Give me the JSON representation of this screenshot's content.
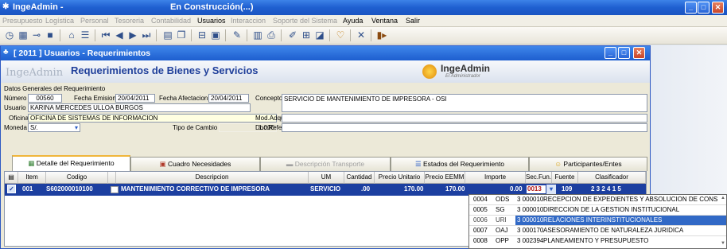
{
  "app": {
    "title": "IngeAdmin -",
    "status": "En Construcción(...)"
  },
  "menu": [
    {
      "label": "Presupuesto",
      "disabled": true
    },
    {
      "label": "Logística",
      "disabled": true
    },
    {
      "label": "Personal",
      "disabled": true
    },
    {
      "label": "Tesoreria",
      "disabled": true
    },
    {
      "label": "Contabilidad",
      "disabled": true
    },
    {
      "label": "Usuarios",
      "disabled": false
    },
    {
      "label": "Interaccion",
      "disabled": true
    },
    {
      "label": "Soporte del Sistema",
      "disabled": true
    },
    {
      "label": "Ayuda",
      "disabled": false
    },
    {
      "label": "Ventana",
      "disabled": false
    },
    {
      "label": "Salir",
      "disabled": false
    }
  ],
  "child": {
    "title": "[ 2011 ] Usuarios - Requerimientos",
    "brand": "IngeAdmin",
    "heading": "Requerimientos de Bienes y Servicios",
    "logo_main": "IngeAdmin",
    "logo_sub": "El Administrador"
  },
  "form": {
    "section": "Datos Generales del Requerimiento",
    "numero_label": "Número",
    "numero": "00560",
    "fecha_emision_label": "Fecha Emision",
    "fecha_emision": "20/04/2011",
    "fecha_afectacion_label": "Fecha Afectacion",
    "fecha_afectacion": "20/04/2011",
    "concepto_label": "Concepto",
    "concepto": "SERVICIO DE MANTENIMIENTO DE IMPRESORA - OSI",
    "usuario_label": "Usuario",
    "usuario": "KARINA MERCEDES ULLOA BURGOS",
    "oficina_label": "Oficina",
    "oficina": "OFICINA DE SISTEMAS DE INFORMACION",
    "mod_adqui_label": "Mod.Adqui:",
    "mod_adqui": "",
    "moneda_label": "Moneda",
    "moneda": "S/.",
    "tipo_cambio_label": "Tipo de Cambio",
    "tipo_cambio": "1.000",
    "doc_refer_label": "Doc.Refer:",
    "doc_refer": ""
  },
  "tabs": [
    {
      "label": "Detalle del Requerimiento",
      "active": true,
      "disabled": false
    },
    {
      "label": "Cuadro Necesidades",
      "active": false,
      "disabled": false
    },
    {
      "label": "Descripción Transporte",
      "active": false,
      "disabled": true
    },
    {
      "label": "Estados del Requerimiento",
      "active": false,
      "disabled": false
    },
    {
      "label": "Participantes/Entes",
      "active": false,
      "disabled": false
    }
  ],
  "grid": {
    "columns": [
      "Item",
      "Codigo",
      "Descripcion",
      "UM",
      "Cantidad",
      "Precio Unitario",
      "Precio EEMM",
      "Importe",
      "Sec.Fun.",
      "Fuente",
      "Clasificador"
    ],
    "row": {
      "item": "001",
      "codigo": "S602000010100",
      "descripcion": "MANTENIMIENTO CORRECTIVO DE IMPRESORA",
      "um": "SERVICIO",
      "cantidad": ".00",
      "precio_unitario": "170.00",
      "precio_eemm": "170.00",
      "importe": "0.00",
      "sec_fun": "0013",
      "fuente": "109",
      "clasificador": "2 3 2 4 1 5"
    }
  },
  "dropdown": [
    {
      "code": "0004",
      "abbr": "ODS",
      "num": "3 000010",
      "desc": "RECEPCION DE EXPEDIENTES Y ABSOLUCION DE CONS",
      "selected": false
    },
    {
      "code": "0005",
      "abbr": "SG",
      "num": "3 000010",
      "desc": "DIRECCION DE LA GESTION INSTITUCIONAL",
      "selected": false
    },
    {
      "code": "0006",
      "abbr": "URI",
      "num": "3 000010",
      "desc": "RELACIONES INTERINSTITUCIONALES",
      "selected": true
    },
    {
      "code": "0007",
      "abbr": "OAJ",
      "num": "3 000170",
      "desc": "ASESORAMIENTO DE NATURALEZA JURIDICA",
      "selected": false
    },
    {
      "code": "0008",
      "abbr": "OPP",
      "num": "3 002394",
      "desc": "PLANEAMIENTO Y PRESUPUESTO",
      "selected": false
    }
  ]
}
